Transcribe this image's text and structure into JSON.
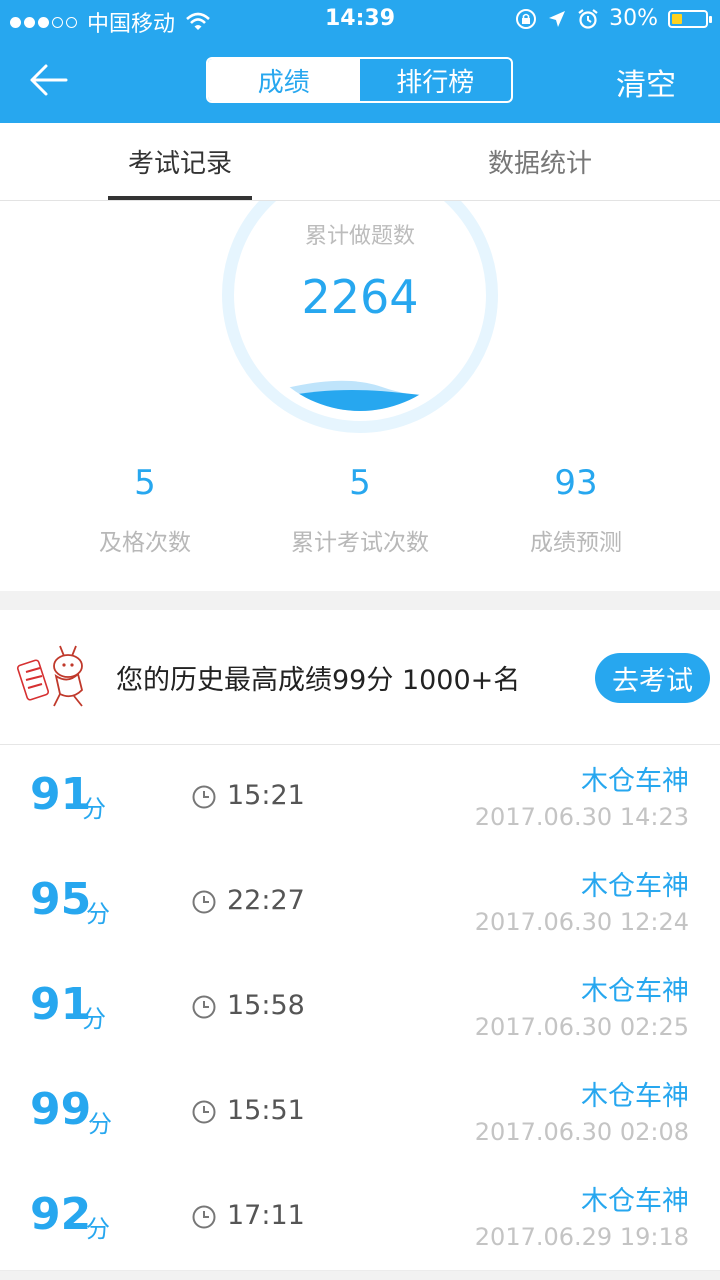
{
  "status_bar": {
    "carrier": "中国移动",
    "time": "14:39",
    "battery": "30%",
    "battery_level": 0.3,
    "icons": [
      "signal-dots-icon",
      "wifi-icon",
      "lock-rotation-icon",
      "location-icon",
      "alarm-icon",
      "battery-icon"
    ]
  },
  "nav": {
    "back_icon": "back-arrow-icon",
    "segments": [
      "成绩",
      "排行榜"
    ],
    "selected_segment": "成绩",
    "clear_label": "清空"
  },
  "tabs": [
    "考试记录",
    "数据统计"
  ],
  "selected_tab": "考试记录",
  "colors": {
    "accent": "#27a7ef",
    "water": "#27a7ef",
    "ring": "#e6f5fe"
  },
  "stats": {
    "total_label": "累计做题数",
    "total_value": "2264",
    "items": [
      {
        "value": "5",
        "label": "及格次数"
      },
      {
        "value": "5",
        "label": "累计考试次数"
      },
      {
        "value": "93",
        "label": "成绩预测"
      }
    ]
  },
  "best": {
    "text": "您的历史最高成绩99分 1000+名",
    "button": "去考试"
  },
  "score_unit": "分",
  "records": [
    {
      "score": "91",
      "duration": "15:21",
      "name": "木仓车神",
      "date": "2017.06.30 14:23"
    },
    {
      "score": "95",
      "duration": "22:27",
      "name": "木仓车神",
      "date": "2017.06.30 12:24"
    },
    {
      "score": "91",
      "duration": "15:58",
      "name": "木仓车神",
      "date": "2017.06.30 02:25"
    },
    {
      "score": "99",
      "duration": "15:51",
      "name": "木仓车神",
      "date": "2017.06.30 02:08"
    },
    {
      "score": "92",
      "duration": "17:11",
      "name": "木仓车神",
      "date": "2017.06.29 19:18"
    }
  ]
}
